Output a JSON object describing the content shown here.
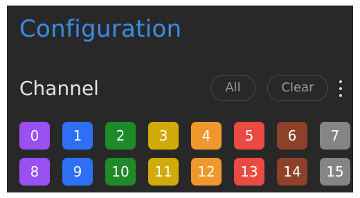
{
  "header": {
    "title": "Configuration"
  },
  "channel": {
    "label": "Channel",
    "all_label": "All",
    "clear_label": "Clear",
    "more_icon": "vertical-ellipsis-icon"
  },
  "channels": [
    {
      "label": "0",
      "color": "#9a4ff0"
    },
    {
      "label": "1",
      "color": "#2f6ff5"
    },
    {
      "label": "2",
      "color": "#1f8a2a"
    },
    {
      "label": "3",
      "color": "#d2aa0a"
    },
    {
      "label": "4",
      "color": "#f0982e"
    },
    {
      "label": "5",
      "color": "#e94a42"
    },
    {
      "label": "6",
      "color": "#8c4128"
    },
    {
      "label": "7",
      "color": "#858585"
    },
    {
      "label": "8",
      "color": "#9a4ff0"
    },
    {
      "label": "9",
      "color": "#2f6ff5"
    },
    {
      "label": "10",
      "color": "#1f8a2a"
    },
    {
      "label": "11",
      "color": "#d2aa0a"
    },
    {
      "label": "12",
      "color": "#f0982e"
    },
    {
      "label": "13",
      "color": "#e94a42"
    },
    {
      "label": "14",
      "color": "#8c4128"
    },
    {
      "label": "15",
      "color": "#858585"
    }
  ]
}
